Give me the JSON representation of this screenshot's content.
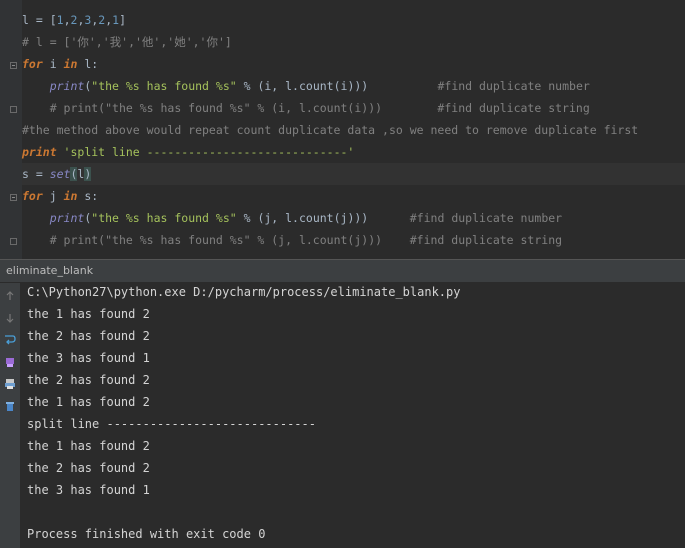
{
  "editor": {
    "line1": {
      "var": "l",
      "op": " = ",
      "open": "[",
      "nums": [
        "1",
        "2",
        "3",
        "2",
        "1"
      ],
      "close": "]"
    },
    "line2": {
      "comment": "# l = ['你','我','他','她','你']"
    },
    "line3": {
      "kw_for": "for",
      "var": " i ",
      "kw_in": "in",
      "rest": " l:"
    },
    "line4": {
      "indent": "    ",
      "fn": "print",
      "p1": "(",
      "str": "\"the %s has found %s\"",
      "p2": " % (i, l.count(i)))",
      "pad": "          ",
      "comment": "#find duplicate number"
    },
    "line5": {
      "indent": "    ",
      "comment": "# print(\"the %s has found %s\" % (i, l.count(i)))        #find duplicate string"
    },
    "line6": {
      "comment": "#the method above would repeat count duplicate data ,so we need to remove duplicate first"
    },
    "line7": {
      "kw_print": "print",
      "str": " 'split line -----------------------------'"
    },
    "line8": {
      "a": "s = ",
      "fn": "set",
      "p_open": "(",
      "arg": "l",
      "p_close": ")"
    },
    "line9": {
      "kw_for": "for",
      "var": " j ",
      "kw_in": "in",
      "rest": " s:"
    },
    "line10": {
      "indent": "    ",
      "fn": "print",
      "p1": "(",
      "str": "\"the %s has found %s\"",
      "p2": " % (j, l.count(j)))",
      "pad": "      ",
      "comment": "#find duplicate number"
    },
    "line11": {
      "indent": "    ",
      "comment": "# print(\"the %s has found %s\" % (j, l.count(j)))    #find duplicate string"
    }
  },
  "tool_window": {
    "title": "eliminate_blank"
  },
  "console": {
    "lines": [
      "C:\\Python27\\python.exe D:/pycharm/process/eliminate_blank.py",
      "the 1 has found 2",
      "the 2 has found 2",
      "the 3 has found 1",
      "the 2 has found 2",
      "the 1 has found 2",
      "split line -----------------------------",
      "the 1 has found 2",
      "the 2 has found 2",
      "the 3 has found 1",
      "",
      "Process finished with exit code 0"
    ]
  },
  "sidebar_icons": [
    "rerun-icon",
    "stop-icon",
    "pin-icon",
    "scroll-icon",
    "print-icon",
    "trash-icon"
  ],
  "colors": {
    "keyword": "#cc7832",
    "builtin": "#8888c6",
    "number": "#6897bb",
    "string": "#a5c25c",
    "comment": "#808080",
    "background": "#2b2b2b"
  }
}
